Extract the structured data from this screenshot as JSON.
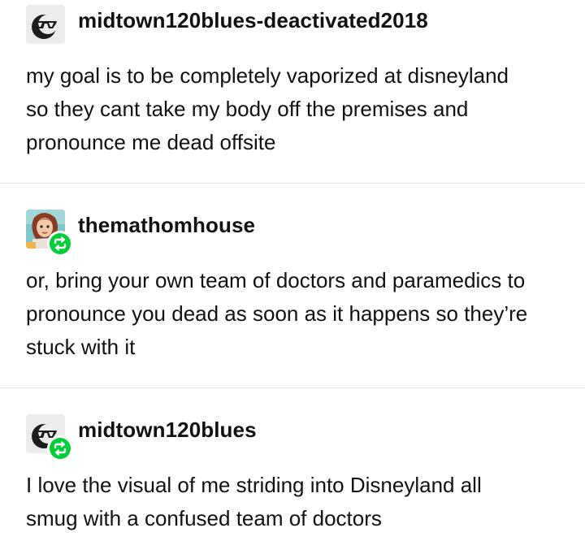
{
  "posts": [
    {
      "username": "midtown120blues-deactivated2018",
      "avatar_icon": "sunglasses-face-icon",
      "reblog": false,
      "lines": [
        "my goal is to be completely vaporized at disneyland",
        "so they cant take my body off the premises and",
        "pronounce me dead offsite"
      ]
    },
    {
      "username": "themathomhouse",
      "avatar_icon": "cartoon-girl-avatar-icon",
      "reblog": true,
      "lines": [
        "or, bring your own team of doctors and paramedics to",
        "pronounce you dead as soon as it happens so they’re",
        "stuck with it"
      ]
    },
    {
      "username": "midtown120blues",
      "avatar_icon": "sunglasses-face-icon",
      "reblog": true,
      "lines": [
        "I love the visual of me striding into Disneyland all",
        "smug with a confused team of doctors"
      ]
    }
  ],
  "colors": {
    "reblog_badge": "#00cf35",
    "text": "#111111",
    "divider": "#e6e6e6"
  }
}
